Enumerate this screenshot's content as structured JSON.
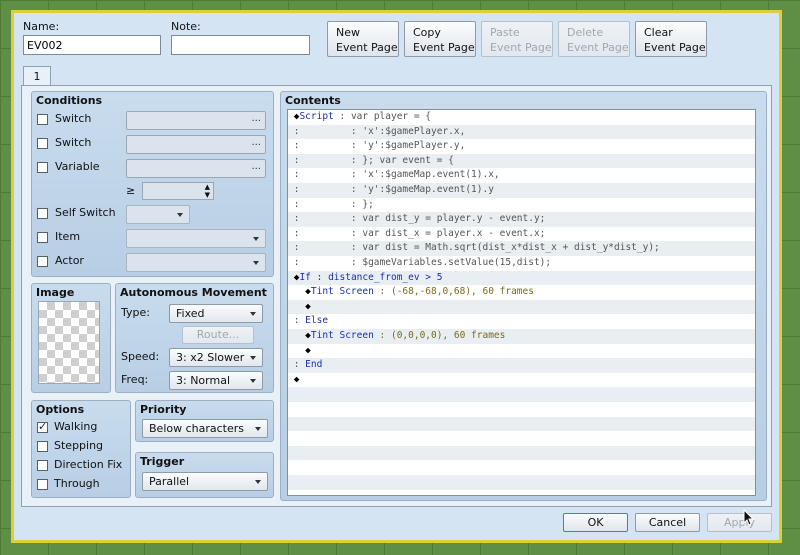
{
  "header": {
    "name_label": "Name:",
    "name_value": "EV002",
    "note_label": "Note:",
    "note_value": ""
  },
  "toolbar": {
    "new_line1": "New",
    "new_line2": "Event Page",
    "copy_line1": "Copy",
    "copy_line2": "Event Page",
    "paste_line1": "Paste",
    "paste_line2": "Event Page",
    "delete_line1": "Delete",
    "delete_line2": "Event Page",
    "clear_line1": "Clear",
    "clear_line2": "Event Page"
  },
  "tabs": {
    "page1": "1"
  },
  "conditions": {
    "title": "Conditions",
    "switch1": "Switch",
    "switch2": "Switch",
    "variable": "Variable",
    "gte": "≥",
    "self_switch": "Self Switch",
    "item": "Item",
    "actor": "Actor",
    "dots": "..."
  },
  "image": {
    "title": "Image"
  },
  "movement": {
    "title": "Autonomous Movement",
    "type_label": "Type:",
    "type_value": "Fixed",
    "route": "Route...",
    "speed_label": "Speed:",
    "speed_value": "3: x2 Slower",
    "freq_label": "Freq:",
    "freq_value": "3: Normal"
  },
  "options": {
    "title": "Options",
    "walking": "Walking",
    "stepping": "Stepping",
    "direction_fix": "Direction Fix",
    "through": "Through",
    "walking_checked": true
  },
  "priority": {
    "title": "Priority",
    "value": "Below characters"
  },
  "trigger": {
    "title": "Trigger",
    "value": "Parallel"
  },
  "contents": {
    "title": "Contents",
    "lines": [
      {
        "a": "◆",
        "b": "Script",
        "c": " : var player = {"
      },
      {
        "a": ":",
        "b": "",
        "c": "         : 'x':$gamePlayer.x,"
      },
      {
        "a": ":",
        "b": "",
        "c": "         : 'y':$gamePlayer.y,"
      },
      {
        "a": ":",
        "b": "",
        "c": "         : }; var event = {"
      },
      {
        "a": ":",
        "b": "",
        "c": "         : 'x':$gameMap.event(1).x,"
      },
      {
        "a": ":",
        "b": "",
        "c": "         : 'y':$gameMap.event(1).y"
      },
      {
        "a": ":",
        "b": "",
        "c": "         : };"
      },
      {
        "a": ":",
        "b": "",
        "c": "         : var dist_y = player.y - event.y;"
      },
      {
        "a": ":",
        "b": "",
        "c": "         : var dist_x = player.x - event.x;"
      },
      {
        "a": ":",
        "b": "",
        "c": "         : var dist = Math.sqrt(dist_x*dist_x + dist_y*dist_y);"
      },
      {
        "a": ":",
        "b": "",
        "c": "         : $gameVariables.setValue(15,dist);"
      },
      {
        "a": "◆",
        "b": "If",
        "c": " : distance_from_ev > 5"
      },
      {
        "a": "  ◆",
        "b": "Tint Screen",
        "c": " : (-68,-68,0,68), 60 frames"
      },
      {
        "a": "  ◆",
        "b": "",
        "c": ""
      },
      {
        "a": ":",
        "b": "Else",
        "c": ""
      },
      {
        "a": "  ◆",
        "b": "Tint Screen",
        "c": " : (0,0,0,0), 60 frames"
      },
      {
        "a": "  ◆",
        "b": "",
        "c": ""
      },
      {
        "a": ":",
        "b": "End",
        "c": ""
      },
      {
        "a": "◆",
        "b": "",
        "c": ""
      }
    ]
  },
  "footer": {
    "ok": "OK",
    "cancel": "Cancel",
    "apply": "Apply"
  },
  "colors": {
    "frame": "#d8d23a",
    "window": "#d4e4f2",
    "keyword": "#1a2fb0"
  }
}
